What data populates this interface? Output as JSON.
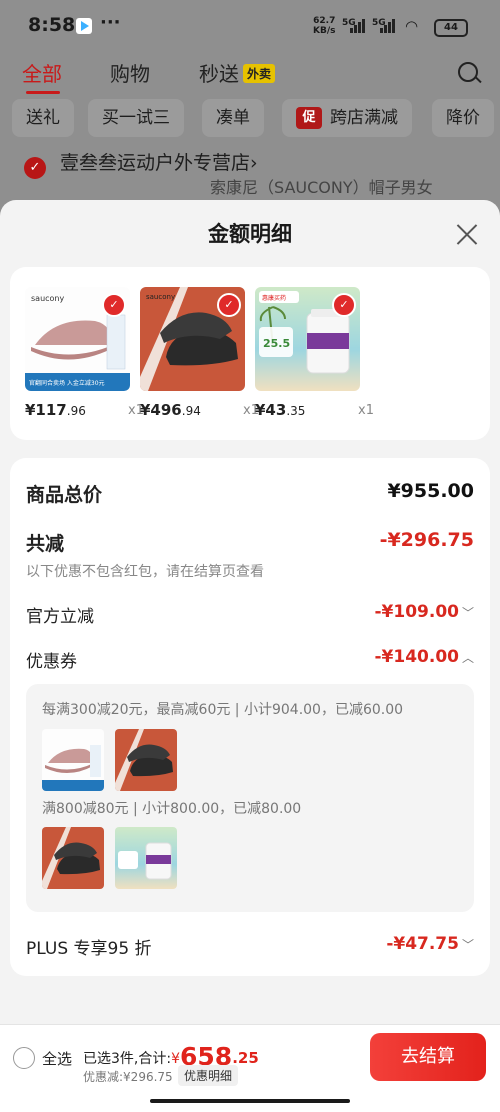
{
  "status": {
    "time": "8:58",
    "dots": "···",
    "speed_top": "62.7",
    "speed_unit": "KB/s",
    "sig1": "5G",
    "sig2": "5G",
    "battery": "44"
  },
  "tabs": {
    "all": "全部",
    "shopping": "购物",
    "instant": "秒送",
    "waimai": "外卖"
  },
  "chips": [
    {
      "label": "送礼"
    },
    {
      "label": "买一试三"
    },
    {
      "label": "凑单"
    },
    {
      "badge": "促",
      "label": "跨店满减"
    },
    {
      "label": "降价"
    }
  ],
  "store": {
    "name": "壹叁叁运动户外专营店",
    "chevron": "›",
    "ghost": "索康尼（SAUCONY）帽子男女"
  },
  "sheet": {
    "title": "金额明细"
  },
  "products": [
    {
      "price_int": "¥117",
      "price_dec": ".96",
      "qty": "x1",
      "brand": "saucony",
      "promo": "官翻同合卖场  入金立减30元"
    },
    {
      "price_int": "¥496",
      "price_dec": ".94",
      "qty": "x1",
      "brand": "saucony"
    },
    {
      "price_int": "¥43",
      "price_dec": ".35",
      "qty": "x1",
      "brand": "惠康买药",
      "badge": "25.5"
    }
  ],
  "summary": {
    "total_label": "商品总价",
    "total_value": "¥955.00",
    "reduce_label": "共减",
    "reduce_value": "-¥296.75",
    "note": "以下优惠不包含红包，请在结算页查看",
    "official_label": "官方立减",
    "official_value": "-¥109.00",
    "coupon_label": "优惠券",
    "coupon_value": "-¥140.00",
    "plus_label": "PLUS 专享95 折",
    "plus_value": "-¥47.75"
  },
  "coupon_rules": [
    {
      "text": "每满300减20元，最高减60元 | 小计904.00，已减60.00"
    },
    {
      "text": "满800减80元 | 小计800.00，已减80.00"
    }
  ],
  "footer": {
    "select_all": "全选",
    "selected": "已选3件,合计:",
    "currency": "¥",
    "amount_int": "658",
    "amount_dec": ".25",
    "discount": "优惠减:¥296.75",
    "detail_chip": "优惠明细",
    "checkout": "去结算"
  }
}
